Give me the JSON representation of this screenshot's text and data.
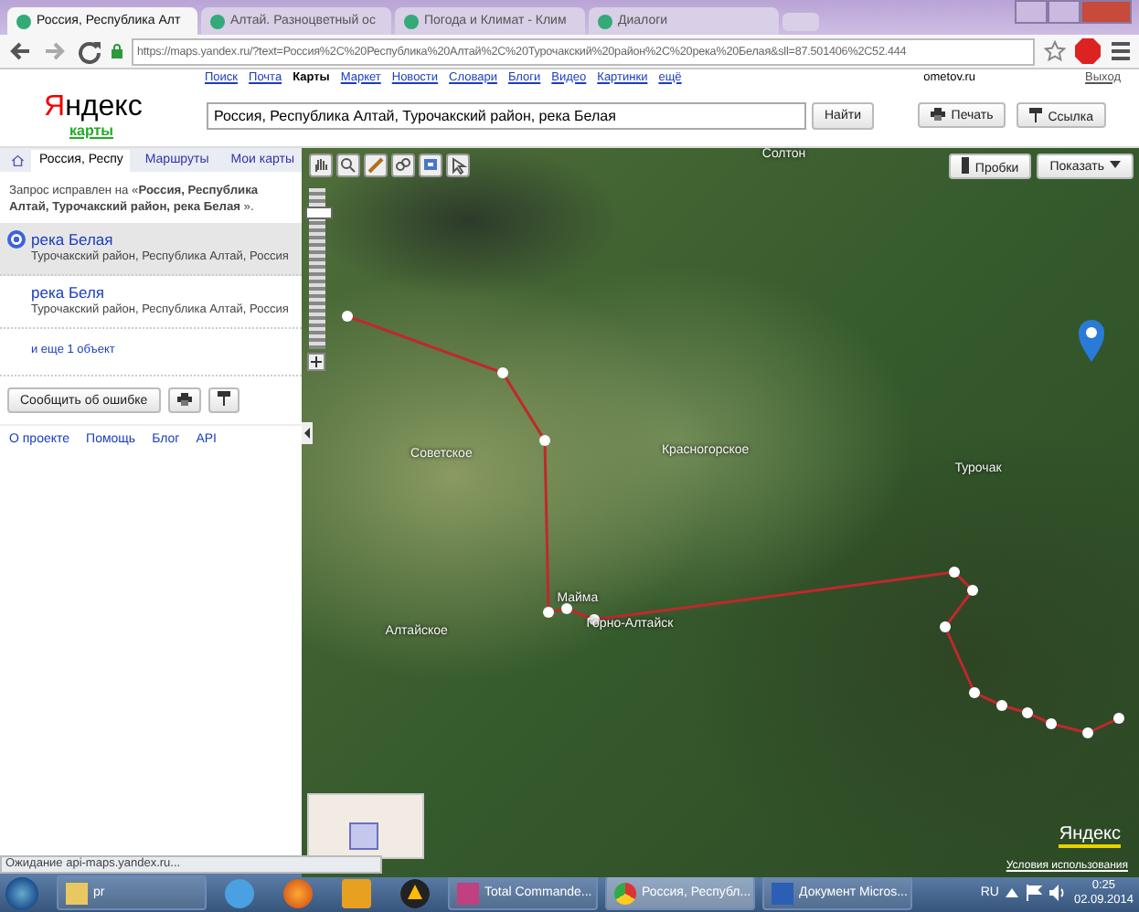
{
  "browser": {
    "tabs": [
      {
        "title": "Россия, Республика Алт",
        "selected": true
      },
      {
        "title": "Алтай. Разноцветный ос",
        "selected": false
      },
      {
        "title": "Погода и Климат - Клим",
        "selected": false
      },
      {
        "title": "Диалоги",
        "selected": false
      }
    ],
    "url": "https://maps.yandex.ru/?text=Россия%2C%20Республика%20Алтай%2C%20Турочакский%20район%2C%20река%20Белая&sll=87.501406%2C52.444",
    "status": "Ожидание api-maps.yandex.ru..."
  },
  "services": [
    {
      "label": "Поиск",
      "selected": false
    },
    {
      "label": "Почта",
      "selected": false
    },
    {
      "label": "Карты",
      "selected": true
    },
    {
      "label": "Маркет",
      "selected": false
    },
    {
      "label": "Новости",
      "selected": false
    },
    {
      "label": "Словари",
      "selected": false
    },
    {
      "label": "Блоги",
      "selected": false
    },
    {
      "label": "Видео",
      "selected": false
    },
    {
      "label": "Картинки",
      "selected": false
    },
    {
      "label": "ещё",
      "selected": false
    }
  ],
  "user": "ometov.ru",
  "logout": "Выход",
  "logo": {
    "first": "Я",
    "rest": "ндекс",
    "sub": "карты"
  },
  "search": {
    "value": "Россия, Республика Алтай, Турочакский район, река Белая",
    "button": "Найти"
  },
  "header_buttons": [
    "Печать",
    "Ссылка"
  ],
  "sidebar": {
    "tabs": [
      {
        "label": "Россия, Респу",
        "selected": true
      },
      {
        "label": "Маршруты",
        "selected": false
      },
      {
        "label": "Мои карты",
        "selected": false
      }
    ],
    "notice": "Запрос исправлен на «**Россия, Республика Алтай, Турочакский район, река Белая** ».",
    "results": [
      {
        "name": "река Белая",
        "address": "Турочакский район, Республика Алтай, Россия",
        "selected": true
      },
      {
        "name": "река Беля",
        "address": "Турочакский район, Республика Алтай, Россия",
        "selected": false
      }
    ],
    "more": "и еще 1 объект",
    "report": "Сообщить об ошибке",
    "footer": [
      "О проекте",
      "Помощь",
      "Блог",
      "API"
    ]
  },
  "map": {
    "traffic": "Пробки",
    "show": "Показать",
    "zoom": {
      "level": 0.85
    },
    "places": [
      "Солтон",
      "Советское",
      "Красногорское",
      "Турочак",
      "Майма",
      "Горно-Алтайск",
      "Алтайское"
    ],
    "logo": "Яндекс",
    "terms": "Условия использования"
  },
  "taskbar": {
    "windows": [
      {
        "label": "pr",
        "kind": "folder",
        "selected": false
      },
      {
        "label": "Total Commande...",
        "kind": "disk",
        "selected": false
      },
      {
        "label": "Россия, Республ...",
        "kind": "chrome",
        "selected": true
      },
      {
        "label": "Документ Micros...",
        "kind": "word",
        "selected": false
      }
    ],
    "lang": "RU",
    "time": "0:25",
    "date": "02.09.2014"
  }
}
